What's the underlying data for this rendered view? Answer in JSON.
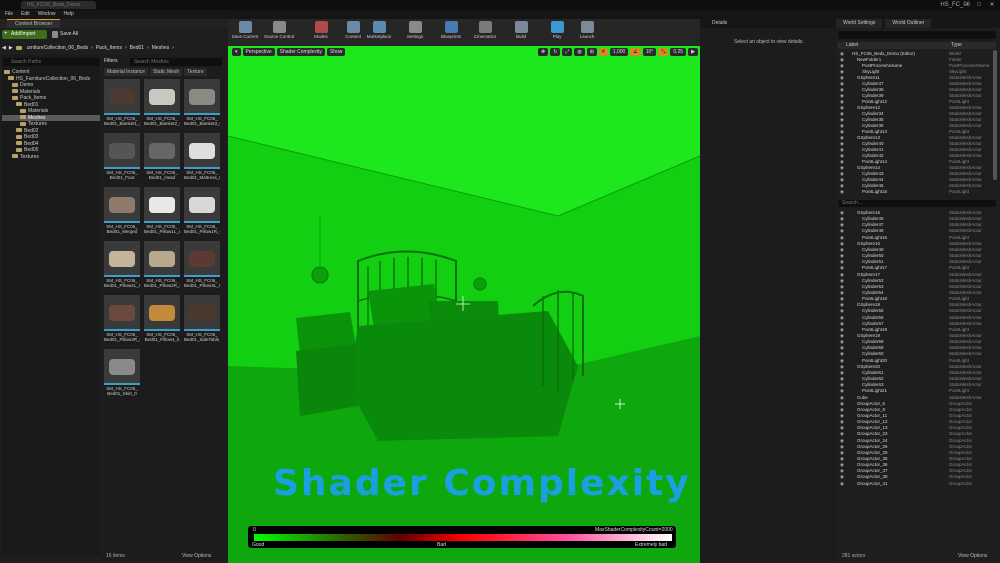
{
  "window": {
    "tab": "HS_FCO6_Beds_Demo",
    "title": "HS_FC_06"
  },
  "menu": [
    "File",
    "Edit",
    "Window",
    "Help"
  ],
  "content_browser": {
    "tab": "Content Browser",
    "add_import": "Add/Import",
    "save_all": "Save All",
    "breadcrumb": [
      "urnitureCollection_06_Beds",
      "Pack_Items",
      "Bed01",
      "Meshes"
    ],
    "search_paths": "Search Paths",
    "tree": [
      {
        "label": "Content",
        "indent": 0
      },
      {
        "label": "HS_FurnitureCollection_06_Beds",
        "indent": 1
      },
      {
        "label": "Demo",
        "indent": 2
      },
      {
        "label": "Materials",
        "indent": 2
      },
      {
        "label": "Pack_Items",
        "indent": 2
      },
      {
        "label": "Bed01",
        "indent": 3
      },
      {
        "label": "Materials",
        "indent": 4
      },
      {
        "label": "Meshes",
        "indent": 4,
        "selected": true
      },
      {
        "label": "Textures",
        "indent": 4
      },
      {
        "label": "Bed02",
        "indent": 3
      },
      {
        "label": "Bed03",
        "indent": 3
      },
      {
        "label": "Bed04",
        "indent": 3
      },
      {
        "label": "Bed05",
        "indent": 3
      },
      {
        "label": "Textures",
        "indent": 2
      }
    ],
    "filters": "Filters",
    "search_assets": "Search Meshes",
    "column_tabs": [
      "Material Instance",
      "Static Mesh",
      "Texture"
    ],
    "assets": [
      {
        "name": "SM_HS_FC06_ Bed01_Blanket1_0",
        "thumb": "#4a3a32"
      },
      {
        "name": "SM_HS_FC06_ Bed01_Blanket2_0",
        "thumb": "#c9c7c2"
      },
      {
        "name": "SM_HS_FC06_ Bed01_Blanket3_0",
        "thumb": "#8a8a84"
      },
      {
        "name": "SM_HS_FC06_ Bed01_Foot Board_Base_0",
        "thumb": "#555555"
      },
      {
        "name": "SM_HS_FC06_ Bed01_Head Board_0",
        "thumb": "#666666"
      },
      {
        "name": "SM_HS_FC06_ Bed01_Mattress_0",
        "thumb": "#dedede"
      },
      {
        "name": "SM_HS_FC06_ Bed01_Merged",
        "thumb": "#8d7a6a"
      },
      {
        "name": "SM_HS_FC06_ Bed01_Pillow1L_0",
        "thumb": "#e8e8e8"
      },
      {
        "name": "SM_HS_FC06_ Bed01_Pillow1R_0",
        "thumb": "#d8d8d8"
      },
      {
        "name": "SM_HS_FC06_ Bed01_Pillow2L_0",
        "thumb": "#c4b59a"
      },
      {
        "name": "SM_HS_FC06_ Bed01_Pillow2R_0",
        "thumb": "#b8a98e"
      },
      {
        "name": "SM_HS_FC06_ Bed01_Pillow3L_0",
        "thumb": "#5a3a32"
      },
      {
        "name": "SM_HS_FC06_ Bed01_Pillow3R_0",
        "thumb": "#6a4a3e"
      },
      {
        "name": "SM_HS_FC06_ Bed01_Pillow4_0",
        "thumb": "#c28a3a"
      },
      {
        "name": "SM_HS_FC06_ Bed01_SideTable_0",
        "thumb": "#4a3a2e"
      },
      {
        "name": "SM_HS_FC06_ Bed01_Skirt_0",
        "thumb": "#8a8a8a"
      }
    ],
    "item_count": "16 items",
    "view_options": "View Options"
  },
  "toolbar": [
    "Save Current",
    "Source Control",
    "Modes",
    "Content",
    "Marketplace",
    "Settings",
    "Blueprints",
    "Cinematics",
    "Build",
    "Play",
    "Launch"
  ],
  "toolbar_colors": [
    "#6a8aa8",
    "#8a8a8a",
    "#b04a4a",
    "#6a8aa8",
    "#5a8ab0",
    "#8a8a8a",
    "#4a7ab0",
    "#7a7a7a",
    "#7a8a9a",
    "#3a9ad0",
    "#7a8a9a"
  ],
  "viewport": {
    "perspective": "Perspective",
    "view_mode": "Shader Complexity",
    "show": "Show",
    "snap_values": [
      "1,000",
      "10°",
      "0.25",
      "1"
    ],
    "overlay_title": "Shader Complexity",
    "legend": {
      "min": "0",
      "max_label": "MaxShaderComplexityCount=2000",
      "good": "Good",
      "bad": "Bad",
      "extremely_bad": "Extremely bad",
      "overlay_color": "#14e014"
    }
  },
  "details": {
    "tab": "Details",
    "message": "Select an object to view details."
  },
  "outliner": {
    "tabs": [
      "World Settings",
      "World Outliner"
    ],
    "col_label": "Label",
    "col_type": "Type",
    "search": "Search...",
    "rows": [
      {
        "label": "HS_FC06_Beds_Demo (Editor)",
        "type": "World",
        "indent": 0
      },
      {
        "label": "NewFolder1",
        "type": "Folder",
        "indent": 1
      },
      {
        "label": "PostProcessVolume",
        "type": "PostProcessVolume",
        "indent": 2
      },
      {
        "label": "SkyLight",
        "type": "SkyLight",
        "indent": 2
      },
      {
        "label": "GSphere11",
        "type": "StaticMeshActor",
        "indent": 1
      },
      {
        "label": "Cylinder37",
        "type": "StaticMeshActor",
        "indent": 2
      },
      {
        "label": "Cylinder38",
        "type": "StaticMeshActor",
        "indent": 2
      },
      {
        "label": "Cylinder39",
        "type": "StaticMeshActor",
        "indent": 2
      },
      {
        "label": "PointLight12",
        "type": "PointLight",
        "indent": 2
      },
      {
        "label": "GSphere12",
        "type": "StaticMeshActor",
        "indent": 1
      },
      {
        "label": "Cylinder34",
        "type": "StaticMeshActor",
        "indent": 2
      },
      {
        "label": "Cylinder35",
        "type": "StaticMeshActor",
        "indent": 2
      },
      {
        "label": "Cylinder36",
        "type": "StaticMeshActor",
        "indent": 2
      },
      {
        "label": "PointLight13",
        "type": "PointLight",
        "indent": 2
      },
      {
        "label": "GSphere13",
        "type": "StaticMeshActor",
        "indent": 1
      },
      {
        "label": "Cylinder40",
        "type": "StaticMeshActor",
        "indent": 2
      },
      {
        "label": "Cylinder41",
        "type": "StaticMeshActor",
        "indent": 2
      },
      {
        "label": "Cylinder42",
        "type": "StaticMeshActor",
        "indent": 2
      },
      {
        "label": "PointLight14",
        "type": "PointLight",
        "indent": 2
      },
      {
        "label": "GSphere14",
        "type": "StaticMeshActor",
        "indent": 1
      },
      {
        "label": "Cylinder43",
        "type": "StaticMeshActor",
        "indent": 2
      },
      {
        "label": "Cylinder44",
        "type": "StaticMeshActor",
        "indent": 2
      },
      {
        "label": "Cylinder45",
        "type": "StaticMeshActor",
        "indent": 2
      },
      {
        "label": "PointLight15",
        "type": "PointLight",
        "indent": 2
      },
      {
        "label": "GSphere15",
        "type": "StaticMeshActor",
        "indent": 1
      },
      {
        "label": "Cylinder46",
        "type": "StaticMeshActor",
        "indent": 2
      },
      {
        "label": "Cylinder47",
        "type": "StaticMeshActor",
        "indent": 2
      },
      {
        "label": "Cylinder48",
        "type": "StaticMeshActor",
        "indent": 2
      },
      {
        "label": "PointLight16",
        "type": "PointLight",
        "indent": 2
      },
      {
        "label": "GSphere16",
        "type": "StaticMeshActor",
        "indent": 1
      },
      {
        "label": "Cylinder49",
        "type": "StaticMeshActor",
        "indent": 2
      },
      {
        "label": "Cylinder50",
        "type": "StaticMeshActor",
        "indent": 2
      },
      {
        "label": "Cylinder51",
        "type": "StaticMeshActor",
        "indent": 2
      },
      {
        "label": "PointLight17",
        "type": "PointLight",
        "indent": 2
      },
      {
        "label": "GSphere17",
        "type": "StaticMeshActor",
        "indent": 1
      },
      {
        "label": "Cylinder52",
        "type": "StaticMeshActor",
        "indent": 2
      },
      {
        "label": "Cylinder53",
        "type": "StaticMeshActor",
        "indent": 2
      },
      {
        "label": "Cylinder54",
        "type": "StaticMeshActor",
        "indent": 2
      },
      {
        "label": "PointLight18",
        "type": "PointLight",
        "indent": 2
      },
      {
        "label": "GSphere18",
        "type": "StaticMeshActor",
        "indent": 1
      },
      {
        "label": "Cylinder55",
        "type": "StaticMeshActor",
        "indent": 2
      },
      {
        "label": "Cylinder56",
        "type": "StaticMeshActor",
        "indent": 2
      },
      {
        "label": "Cylinder57",
        "type": "StaticMeshActor",
        "indent": 2
      },
      {
        "label": "PointLight19",
        "type": "PointLight",
        "indent": 2
      },
      {
        "label": "GSphere19",
        "type": "StaticMeshActor",
        "indent": 1
      },
      {
        "label": "Cylinder58",
        "type": "StaticMeshActor",
        "indent": 2
      },
      {
        "label": "Cylinder59",
        "type": "StaticMeshActor",
        "indent": 2
      },
      {
        "label": "Cylinder60",
        "type": "StaticMeshActor",
        "indent": 2
      },
      {
        "label": "PointLight20",
        "type": "PointLight",
        "indent": 2
      },
      {
        "label": "GSphere20",
        "type": "StaticMeshActor",
        "indent": 1
      },
      {
        "label": "Cylinder61",
        "type": "StaticMeshActor",
        "indent": 2
      },
      {
        "label": "Cylinder62",
        "type": "StaticMeshActor",
        "indent": 2
      },
      {
        "label": "Cylinder63",
        "type": "StaticMeshActor",
        "indent": 2
      },
      {
        "label": "PointLight21",
        "type": "PointLight",
        "indent": 2
      },
      {
        "label": "Cube",
        "type": "StaticMeshActor",
        "indent": 1
      },
      {
        "label": "GroupActor_6",
        "type": "GroupActor",
        "indent": 1
      },
      {
        "label": "GroupActor_8",
        "type": "GroupActor",
        "indent": 1
      },
      {
        "label": "GroupActor_11",
        "type": "GroupActor",
        "indent": 1
      },
      {
        "label": "GroupActor_12",
        "type": "GroupActor",
        "indent": 1
      },
      {
        "label": "GroupActor_13",
        "type": "GroupActor",
        "indent": 1
      },
      {
        "label": "GroupActor_23",
        "type": "GroupActor",
        "indent": 1
      },
      {
        "label": "GroupActor_24",
        "type": "GroupActor",
        "indent": 1
      },
      {
        "label": "GroupActor_26",
        "type": "GroupActor",
        "indent": 1
      },
      {
        "label": "GroupActor_28",
        "type": "GroupActor",
        "indent": 1
      },
      {
        "label": "GroupActor_35",
        "type": "GroupActor",
        "indent": 1
      },
      {
        "label": "GroupActor_36",
        "type": "GroupActor",
        "indent": 1
      },
      {
        "label": "GroupActor_37",
        "type": "GroupActor",
        "indent": 1
      },
      {
        "label": "GroupActor_38",
        "type": "GroupActor",
        "indent": 1
      },
      {
        "label": "GroupActor_41",
        "type": "GroupActor",
        "indent": 1
      }
    ],
    "actor_count": "281 actors",
    "view_options": "View Options"
  }
}
